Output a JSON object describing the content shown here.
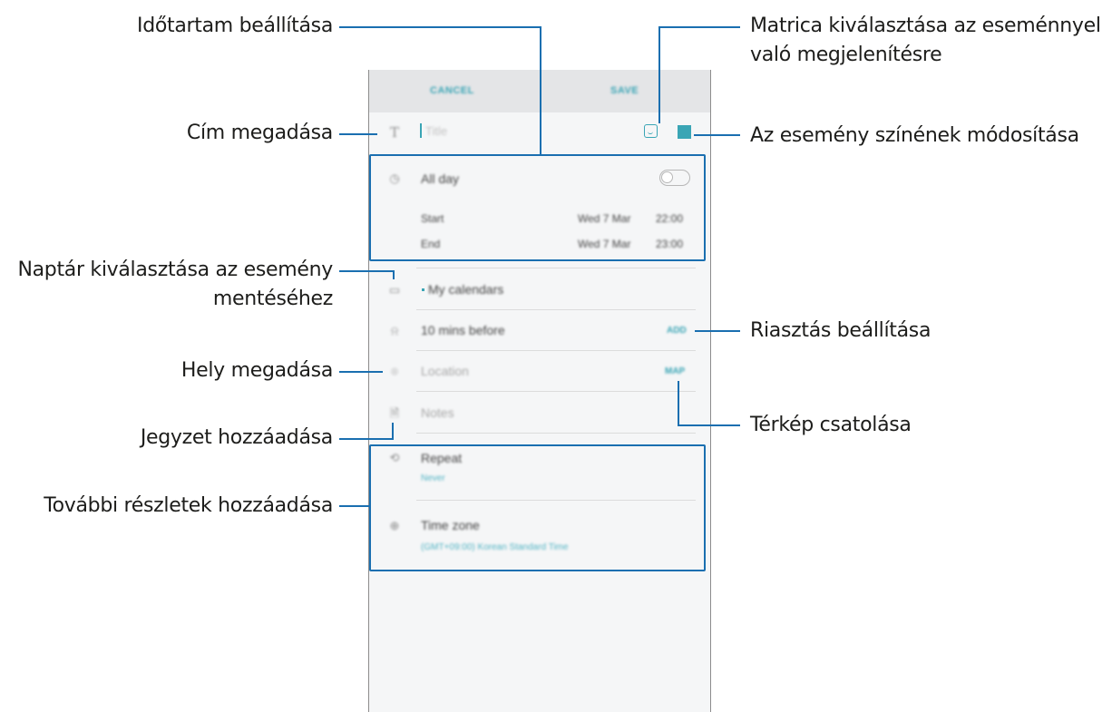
{
  "callouts": {
    "duration": "Időtartam beállítása",
    "sticker_line1": "Matrica kiválasztása az eseménnyel",
    "sticker_line2": "való megjelenítésre",
    "title": "Cím megadása",
    "color": "Az esemény színének módosítása",
    "calendar_line1": "Naptár kiválasztása az esemény",
    "calendar_line2": "mentéséhez",
    "alarm": "Riasztás beállítása",
    "location": "Hely megadása",
    "map": "Térkép csatolása",
    "note": "Jegyzet hozzáadása",
    "details": "További részletek hozzáadása"
  },
  "phone": {
    "header": {
      "cancel": "CANCEL",
      "save": "SAVE"
    },
    "title_placeholder": "Title",
    "all_day": "All day",
    "all_day_enabled": false,
    "start": {
      "label": "Start",
      "date": "Wed 7 Mar",
      "time": "22:00"
    },
    "end": {
      "label": "End",
      "date": "Wed 7 Mar",
      "time": "23:00"
    },
    "calendar": "My calendars",
    "alarm": {
      "text": "10 mins before",
      "action": "ADD"
    },
    "location": {
      "placeholder": "Location",
      "action": "MAP"
    },
    "notes_placeholder": "Notes",
    "repeat": {
      "label": "Repeat",
      "value": "Never"
    },
    "timezone": {
      "label": "Time zone",
      "value": "(GMT+09:00) Korean Standard Time"
    }
  },
  "icons": {
    "title": "text-t-icon",
    "time": "clock-icon",
    "calendar": "calendar-icon",
    "alarm": "bell-icon",
    "location": "location-pin-icon",
    "notes": "note-icon",
    "repeat": "repeat-icon",
    "timezone": "globe-icon",
    "sticker": "sticker-icon"
  },
  "colors": {
    "accent": "#3aa5b5",
    "callout_line": "#1a6fb0"
  }
}
